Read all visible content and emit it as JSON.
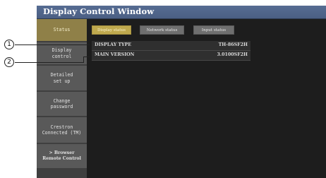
{
  "window": {
    "title": "Display Control Window"
  },
  "sidebar": {
    "items": [
      {
        "label": "Status",
        "active": true
      },
      {
        "label": "Display\ncontrol",
        "active": false
      },
      {
        "label": "Detailed\nset up",
        "active": false
      },
      {
        "label": "Change\npassword",
        "active": false
      },
      {
        "label": "Crestron\nConnected (TM)",
        "active": false
      },
      {
        "label": "> Browser\nRemote Control",
        "active": false
      }
    ]
  },
  "tabs": [
    {
      "label": "Display status",
      "active": true
    },
    {
      "label": "Network status",
      "active": false
    },
    {
      "label": "Input status",
      "active": false
    }
  ],
  "status_rows": [
    {
      "label": "DISPLAY TYPE",
      "value": "TH-86SF2H"
    },
    {
      "label": "MAIN VERSION",
      "value": "3.0100SF2H"
    }
  ],
  "callouts": [
    "1",
    "2"
  ],
  "colors": {
    "titlebar": "#516690",
    "active_tab": "#bfa94e",
    "active_side": "#8f8048"
  }
}
